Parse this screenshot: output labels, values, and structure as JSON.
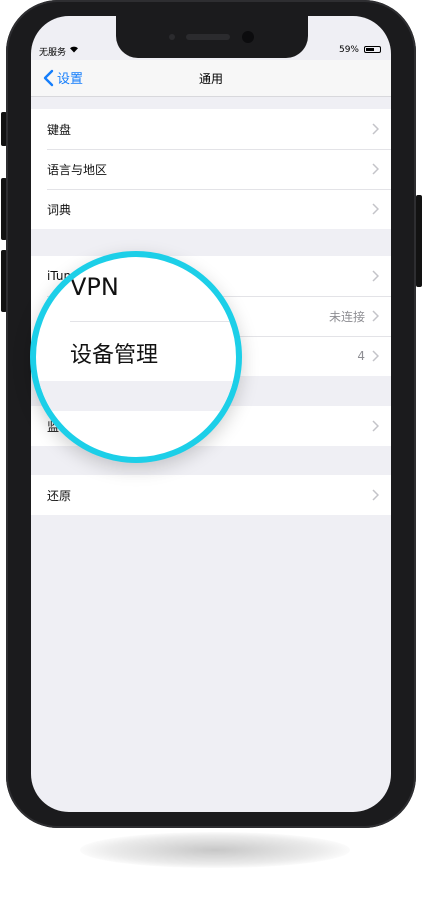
{
  "status_bar": {
    "carrier": "无服务",
    "battery": "59%"
  },
  "nav": {
    "back_label": "设置",
    "title": "通用"
  },
  "groups": [
    {
      "rows": [
        {
          "label": "键盘"
        },
        {
          "label": "语言与地区"
        },
        {
          "label": "词典"
        }
      ]
    },
    {
      "rows": [
        {
          "label": "iTunes"
        },
        {
          "label": "",
          "value": "未连接"
        },
        {
          "label": "",
          "value": "4"
        }
      ]
    },
    {
      "rows": [
        {
          "label": "监"
        }
      ]
    },
    {
      "rows": [
        {
          "label": "还原"
        }
      ]
    }
  ],
  "magnifier": {
    "vpn_label": "VPN",
    "device_mgmt_label": "设备管理"
  },
  "colors": {
    "accent": "#157efb",
    "ring": "#1ccfe8",
    "background": "#efeff4"
  }
}
